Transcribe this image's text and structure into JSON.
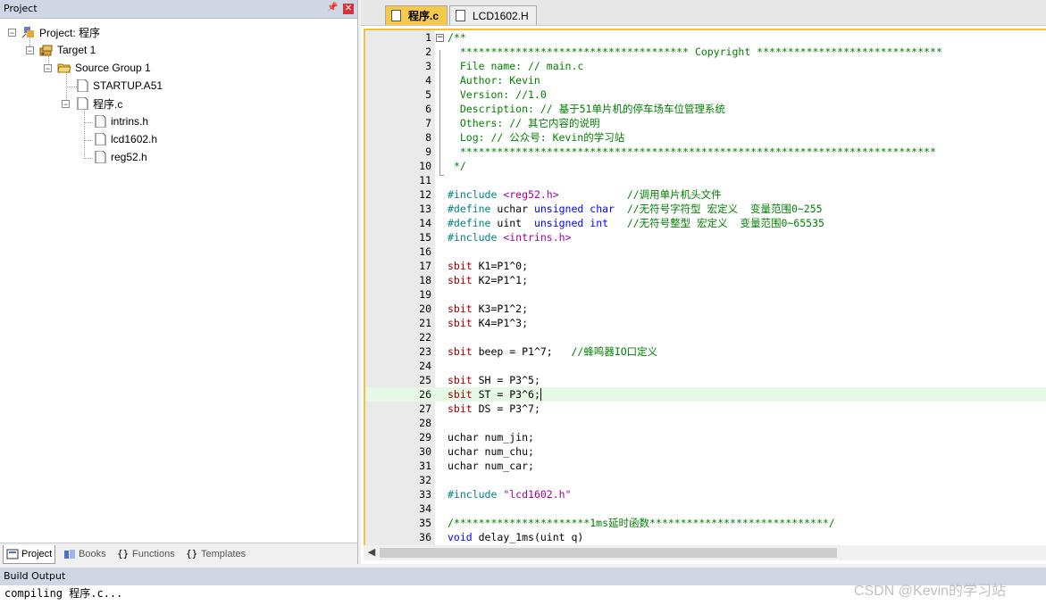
{
  "project_panel": {
    "title": "Project",
    "pin": "↕",
    "close": "x",
    "tree": {
      "root": "Project: 程序",
      "target": "Target 1",
      "group": "Source Group 1",
      "files": [
        "STARTUP.A51",
        "程序.c"
      ],
      "includes": [
        "intrins.h",
        "lcd1602.h",
        "reg52.h"
      ]
    },
    "tabs": [
      "Project",
      "Books",
      "Functions",
      "Templates"
    ]
  },
  "editor": {
    "tabs": [
      "程序.c",
      "LCD1602.H"
    ],
    "active_tab": 0,
    "cursor_line": 26,
    "lines": [
      {
        "n": 1,
        "t": "/**"
      },
      {
        "n": 2,
        "t": "  ************************************* Copyright ******************************"
      },
      {
        "n": 3,
        "t": "  File name: // main.c"
      },
      {
        "n": 4,
        "t": "  Author: Kevin"
      },
      {
        "n": 5,
        "t": "  Version: //1.0"
      },
      {
        "n": 6,
        "t": "  Description: // 基于51单片机的停车场车位管理系统"
      },
      {
        "n": 7,
        "t": "  Others: // 其它内容的说明"
      },
      {
        "n": 8,
        "t": "  Log: // 公众号: Kevin的学习站"
      },
      {
        "n": 9,
        "t": "  *****************************************************************************"
      },
      {
        "n": 10,
        "t": " */"
      },
      {
        "n": 11,
        "t": ""
      },
      {
        "n": 12,
        "t": "#include <reg52.h>           //调用单片机头文件"
      },
      {
        "n": 13,
        "t": "#define uchar unsigned char  //无符号字符型 宏定义  变量范围0~255"
      },
      {
        "n": 14,
        "t": "#define uint  unsigned int   //无符号整型 宏定义  变量范围0~65535"
      },
      {
        "n": 15,
        "t": "#include <intrins.h>"
      },
      {
        "n": 16,
        "t": ""
      },
      {
        "n": 17,
        "t": "sbit K1=P1^0;"
      },
      {
        "n": 18,
        "t": "sbit K2=P1^1;"
      },
      {
        "n": 19,
        "t": ""
      },
      {
        "n": 20,
        "t": "sbit K3=P1^2;"
      },
      {
        "n": 21,
        "t": "sbit K4=P1^3;"
      },
      {
        "n": 22,
        "t": ""
      },
      {
        "n": 23,
        "t": "sbit beep = P1^7;   //蜂鸣器IO口定义"
      },
      {
        "n": 24,
        "t": ""
      },
      {
        "n": 25,
        "t": "sbit SH = P3^5;"
      },
      {
        "n": 26,
        "t": "sbit ST = P3^6;"
      },
      {
        "n": 27,
        "t": "sbit DS = P3^7;"
      },
      {
        "n": 28,
        "t": ""
      },
      {
        "n": 29,
        "t": "uchar num_jin;"
      },
      {
        "n": 30,
        "t": "uchar num_chu;"
      },
      {
        "n": 31,
        "t": "uchar num_car;"
      },
      {
        "n": 32,
        "t": ""
      },
      {
        "n": 33,
        "t": "#include \"lcd1602.h\""
      },
      {
        "n": 34,
        "t": ""
      },
      {
        "n": 35,
        "t": "/**********************1ms延时函数*****************************/"
      },
      {
        "n": 36,
        "t": "void delay_1ms(uint q)"
      }
    ]
  },
  "build_output": {
    "title": "Build Output",
    "text": "compiling 程序.c..."
  },
  "watermark": "CSDN @Kevin的学习站",
  "colors": {
    "panel_header": "#cfd7e5",
    "active_tab": "#f6c94b",
    "comment": "#008000",
    "keyword": "#0000ff",
    "preprocessor": "#008080",
    "string": "#a000a0",
    "current_line": "#e6f8e6"
  }
}
